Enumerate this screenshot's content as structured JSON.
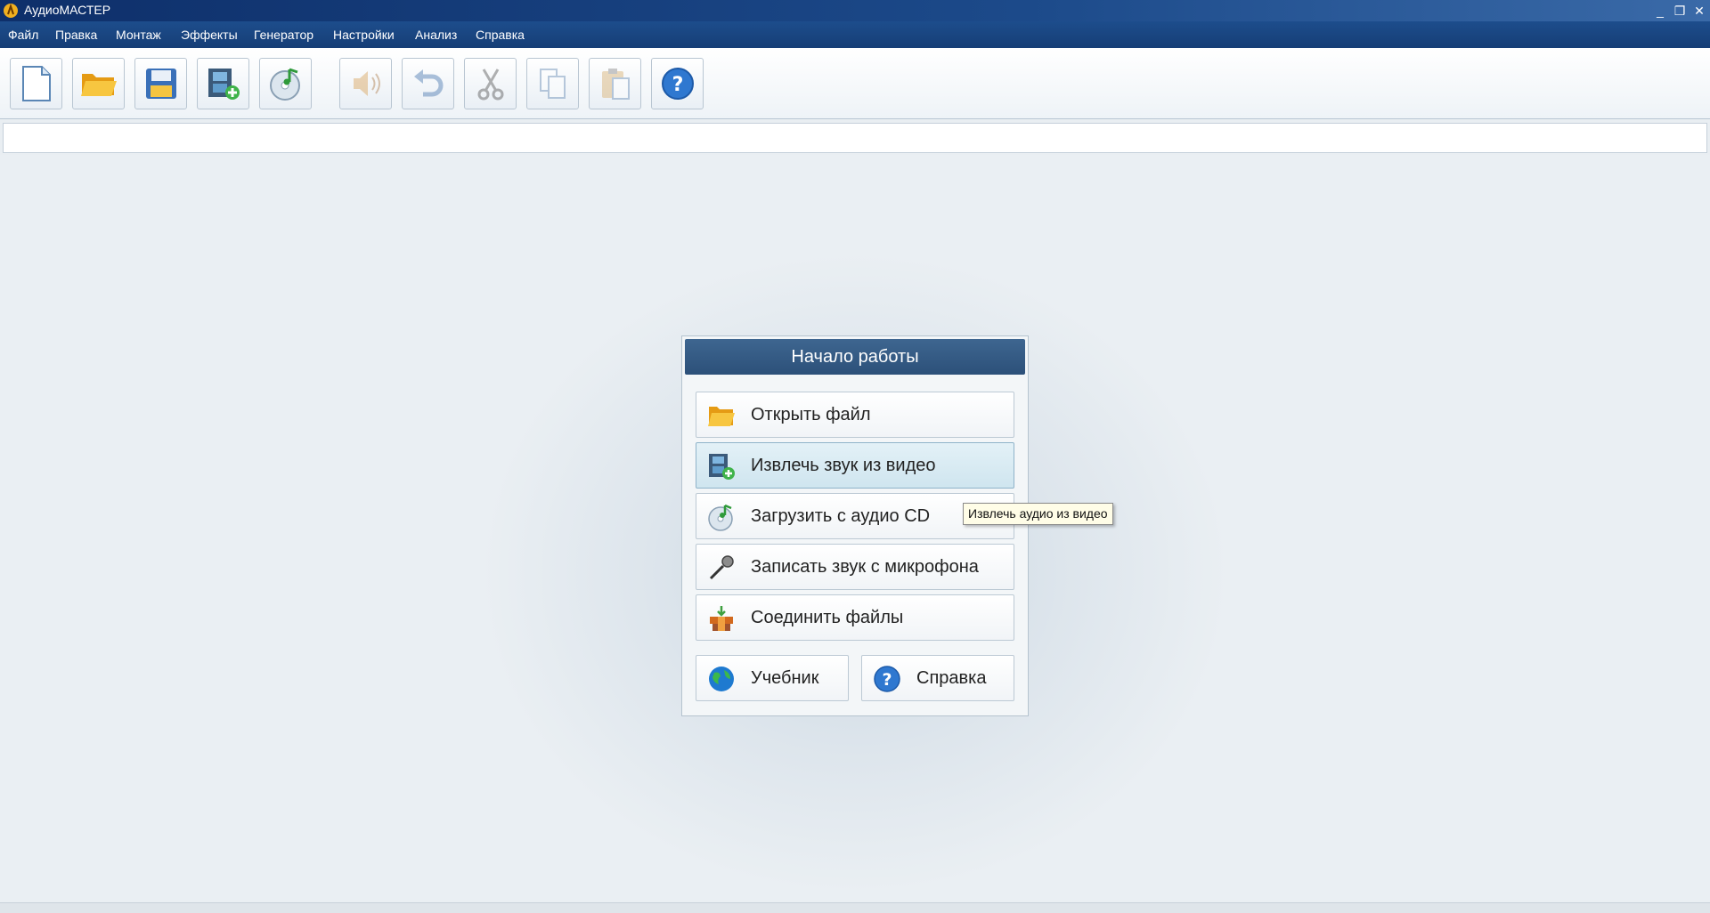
{
  "window": {
    "title": "АудиоМАСТЕР",
    "minimize_glyph": "_",
    "restore_glyph": "❐",
    "close_glyph": "✕"
  },
  "menu": {
    "items": [
      "Файл",
      "Правка",
      "Монтаж",
      "Эффекты",
      "Генератор",
      "Настройки",
      "Анализ",
      "Справка"
    ]
  },
  "toolbar": {
    "buttons": [
      {
        "icon": "new-file-icon",
        "enabled": true
      },
      {
        "icon": "open-folder-icon",
        "enabled": true
      },
      {
        "icon": "save-icon",
        "enabled": true
      },
      {
        "icon": "extract-video-icon",
        "enabled": true
      },
      {
        "icon": "audio-cd-icon",
        "enabled": true
      },
      {
        "icon": "play-speaker-icon",
        "enabled": false
      },
      {
        "icon": "undo-icon",
        "enabled": false
      },
      {
        "icon": "cut-icon",
        "enabled": false
      },
      {
        "icon": "copy-icon",
        "enabled": false
      },
      {
        "icon": "paste-icon",
        "enabled": false
      },
      {
        "icon": "help-icon",
        "enabled": true
      }
    ]
  },
  "start_panel": {
    "title": "Начало работы",
    "actions": [
      {
        "label": "Открыть файл",
        "icon": "open-folder-icon"
      },
      {
        "label": "Извлечь звук из видео",
        "icon": "extract-video-icon",
        "highlighted": true
      },
      {
        "label": "Загрузить с аудио CD",
        "icon": "audio-cd-icon"
      },
      {
        "label": "Записать звук с микрофона",
        "icon": "microphone-icon"
      },
      {
        "label": "Соединить файлы",
        "icon": "join-files-icon"
      }
    ],
    "secondary": [
      {
        "label": "Учебник",
        "icon": "globe-icon"
      },
      {
        "label": "Справка",
        "icon": "help-icon"
      }
    ]
  },
  "tooltip": {
    "text": "Извлечь аудио из видео"
  },
  "colors": {
    "titlebar": "#0e2f6a",
    "menubar": "#1d4d8c",
    "panel_header": "#2c5079",
    "highlight": "#cfe5ef"
  }
}
